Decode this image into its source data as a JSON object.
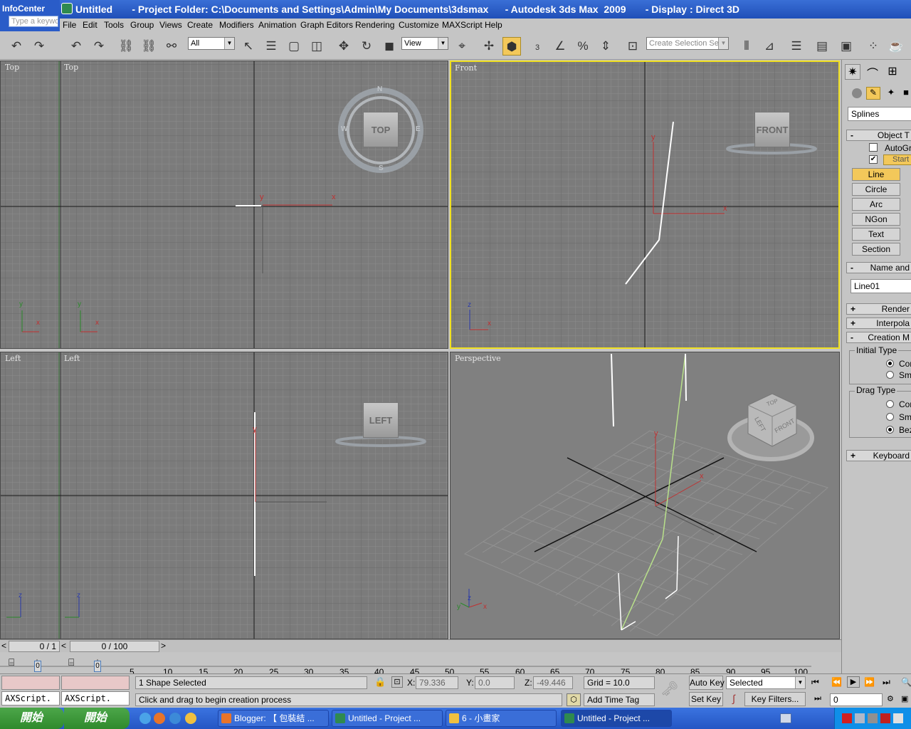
{
  "titlebar": {
    "text": "Untitled       - Project Folder: C:\\Documents and Settings\\Admin\\My Documents\\3dsmax      - Autodesk 3ds Max  2009       - Display : Direct 3D"
  },
  "infocenter": {
    "label": "InfoCenter",
    "search_placeholder": "Type a keywo"
  },
  "menu": [
    "File",
    "Edit",
    "Tools",
    "Group",
    "Views",
    "Create",
    "Modifiers",
    "Animation",
    "Graph Editors",
    "Rendering",
    "Customize",
    "MAXScript",
    "Help"
  ],
  "toolbar": {
    "filter_value": "All",
    "refcoord_value": "View",
    "selection_set_placeholder": "Create Selection Set",
    "snap_angle_label": "3",
    "percent_label": "%"
  },
  "viewports": {
    "top": {
      "label": "Top",
      "cube_label": "TOP",
      "compass": [
        "N",
        "S",
        "E",
        "W"
      ]
    },
    "top_inner": {
      "label": "Top"
    },
    "front": {
      "label": "Front",
      "cube_label": "FRONT"
    },
    "left": {
      "label": "Left",
      "cube_label": "LEFT"
    },
    "left_inner": {
      "label": "Left"
    },
    "perspective": {
      "label": "Perspective",
      "cube_faces": [
        "TOP",
        "LEFT",
        "FRONT"
      ]
    },
    "axis": {
      "x": "x",
      "y": "y",
      "z": "z"
    }
  },
  "command_panel": {
    "category": "Splines",
    "rollout_object_type": "Object T",
    "autogrid_label": "AutoGri",
    "start_label": "Start I",
    "object_buttons": [
      "Line",
      "Circle",
      "Arc",
      "NGon",
      "Text",
      "Section"
    ],
    "rollout_name": "Name and",
    "name_value": "Line01",
    "rollout_render": "Render",
    "rollout_interp": "Interpola",
    "rollout_creation": "Creation M",
    "initial_type_label": "Initial Type",
    "initial_type_options": [
      "Cor",
      "Smo"
    ],
    "drag_type_label": "Drag Type",
    "drag_type_options": [
      "Cor",
      "Smo",
      "Bez"
    ],
    "rollout_keyboard": "Keyboard"
  },
  "timeslider": {
    "left_value": "0 / 1",
    "main_value": "0 / 100",
    "nav_prev": "<",
    "nav_next": ">"
  },
  "trackbar": {
    "ticks": [
      "5",
      "10",
      "15",
      "20",
      "25",
      "30",
      "35",
      "40",
      "45",
      "50",
      "55",
      "60",
      "65",
      "70",
      "75",
      "80",
      "85",
      "90",
      "95",
      "100"
    ],
    "start_frame_1": "0",
    "start_frame_2": "0"
  },
  "status": {
    "maxscript_label_1": "AXScript.",
    "maxscript_label_2": "AXScript.",
    "selection_text": "1 Shape Selected",
    "prompt_text": "Click and drag to begin creation process",
    "x_label": "X:",
    "x_value": "79.336",
    "y_label": "Y:",
    "y_value": "0.0",
    "z_label": "Z:",
    "z_value": "-49.446",
    "grid_text": "Grid = 10.0",
    "add_time_tag": "Add Time Tag",
    "auto_key": "Auto Key",
    "set_key": "Set Key",
    "key_mode_value": "Selected",
    "key_filters": "Key Filters...",
    "current_frame": "0"
  },
  "taskbar": {
    "start_1": "開始",
    "start_2": "開始",
    "tasks": [
      "Blogger: 【 包裝結 ...",
      "Untitled      - Project ...",
      "6 - 小畫家",
      "Untitled      - Project ..."
    ]
  },
  "colors": {
    "accent_active": "#f0e020",
    "title_blue": "#2a5cc8",
    "viewport_bg": "#7b7b7b"
  }
}
